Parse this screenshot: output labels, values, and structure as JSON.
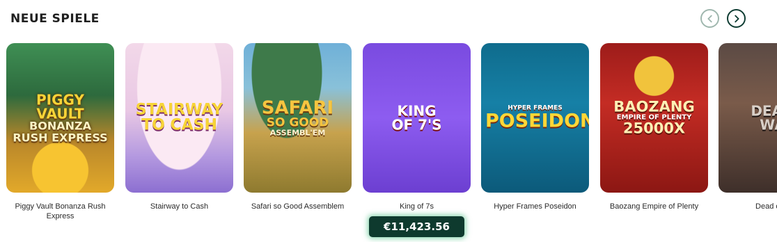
{
  "header": {
    "title": "NEUE SPIELE"
  },
  "nav": {
    "prev_icon": "chevron-left-icon",
    "next_icon": "chevron-right-icon"
  },
  "games": [
    {
      "name": "Piggy Vault Bonanza Rush Express",
      "logo": [
        "PIGGY",
        "VAULT",
        "BONANZA",
        "RUSH EXPRESS"
      ]
    },
    {
      "name": "Stairway to Cash",
      "logo": [
        "STAIRWAY",
        "TO CASH"
      ]
    },
    {
      "name": "Safari so Good Assemblem",
      "logo": [
        "SAFARI",
        "SO GOOD",
        "ASSEMBL'EM"
      ]
    },
    {
      "name": "King of 7s",
      "logo": [
        "KING",
        "OF 7'S"
      ]
    },
    {
      "name": "Hyper Frames Poseidon",
      "logo": [
        "HYPER FRAMES",
        "POSEIDON"
      ]
    },
    {
      "name": "Baozang Empire of Plenty",
      "logo": [
        "BAOZANG",
        "EMPIRE OF PLENTY",
        "25000X"
      ]
    },
    {
      "name": "Dead or A",
      "logo": [
        "DEAD",
        "WA"
      ]
    }
  ],
  "jackpot": {
    "value": "€11,423.56"
  },
  "colors": {
    "accent": "#0f3d33",
    "jackpot_bg": "#0e3a2e"
  }
}
